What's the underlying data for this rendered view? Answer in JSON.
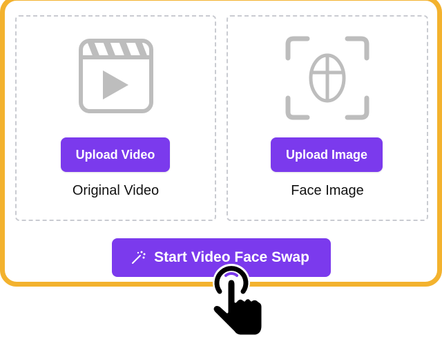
{
  "panels": [
    {
      "icon": "video-clapperboard-icon",
      "button_label": "Upload Video",
      "label": "Original Video"
    },
    {
      "icon": "face-scan-icon",
      "button_label": "Upload Image",
      "label": "Face Image"
    }
  ],
  "start_button": {
    "icon": "magic-wand-icon",
    "label": "Start Video Face Swap"
  },
  "cursor": {
    "icon": "hand-pointer-click-icon"
  },
  "colors": {
    "accent": "#7B3AED",
    "frame_border": "#F3B22E",
    "icon_gray": "#BDBDBD",
    "dashed_border": "#C9CBD1"
  }
}
